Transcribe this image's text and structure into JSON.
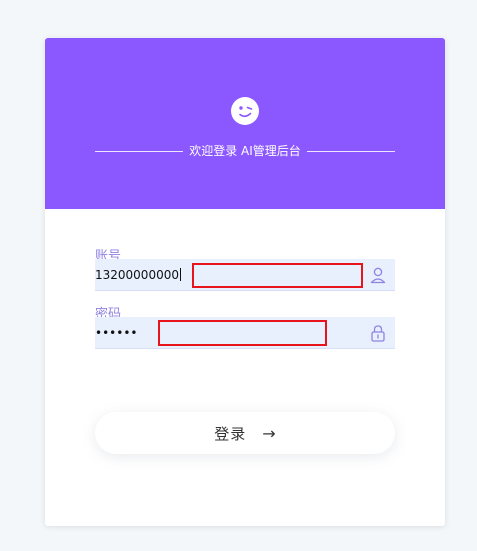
{
  "header": {
    "logo_icon": "smiley-wink-icon",
    "title": "欢迎登录 AI管理后台"
  },
  "form": {
    "account": {
      "label": "账号",
      "value": "13200000000",
      "icon": "user-icon"
    },
    "password": {
      "label": "密码",
      "value": "••••••",
      "icon": "lock-icon"
    },
    "submit": {
      "label": "登录",
      "arrow": "→",
      "icon": "arrow-right-icon"
    }
  },
  "colors": {
    "page_background": "#f3f7f9",
    "header_background": "#8b58ff",
    "label": "#8f82e2",
    "input_background": "#e8f0fe",
    "highlight": "#e8141b"
  }
}
